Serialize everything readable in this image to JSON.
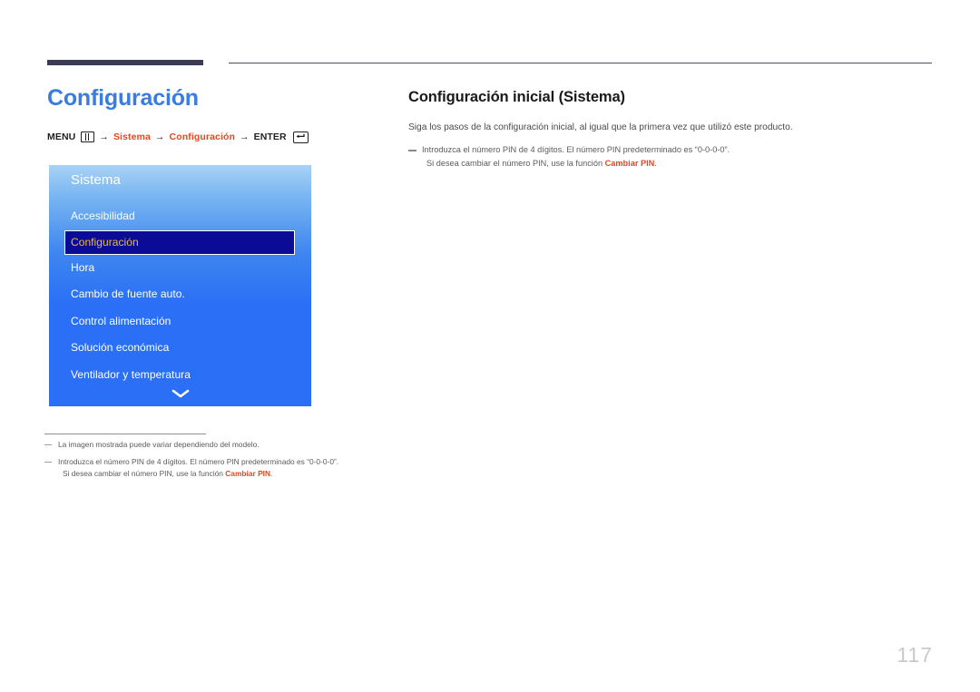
{
  "header": {
    "rule_thick_color": "#3b3b56",
    "rule_thin_color": "#4d4d63"
  },
  "left": {
    "title": "Configuración",
    "title_color": "#3a7ce0",
    "breadcrumb": {
      "menu_label": "MENU",
      "menu_icon": "menu-grid-icon",
      "arrow": "→",
      "item1": "Sistema",
      "item2": "Configuración",
      "enter_label": "ENTER",
      "enter_icon": "enter-return-icon",
      "accent_color": "#e8451f"
    },
    "osd": {
      "header": "Sistema",
      "panel_color": "#2a6ff5",
      "selected_bg": "#0b0b96",
      "selected_text_color": "#e8bd3c",
      "scroll_icon": "chevron-down-icon",
      "items": [
        {
          "label": "Accesibilidad",
          "selected": false
        },
        {
          "label": "Configuración",
          "selected": true
        },
        {
          "label": "Hora",
          "selected": false
        },
        {
          "label": "Cambio de fuente auto.",
          "selected": false
        },
        {
          "label": "Control alimentación",
          "selected": false
        },
        {
          "label": "Solución económica",
          "selected": false
        },
        {
          "label": "Ventilador y temperatura",
          "selected": false
        }
      ]
    },
    "footnotes": [
      {
        "line1": "La imagen mostrada puede variar dependiendo del modelo.",
        "line2": "",
        "line2_prefix": "",
        "line2_highlight": "",
        "line2_suffix": ""
      },
      {
        "line1": "Introduzca el número PIN de 4 dígitos. El número PIN predeterminado es “0-0-0-0”.",
        "line2_prefix": "Si desea cambiar el número PIN, use la función ",
        "line2_highlight": "Cambiar PIN",
        "line2_suffix": "."
      }
    ]
  },
  "right": {
    "title": "Configuración inicial (Sistema)",
    "lead": "Siga los pasos de la configuración inicial, al igual que la primera vez que utilizó este producto.",
    "note": {
      "line1": "Introduzca el número PIN de 4 dígitos. El número PIN predeterminado es “0-0-0-0”.",
      "line2_prefix": "Si desea cambiar el número PIN, use la función ",
      "line2_highlight": "Cambiar PIN",
      "line2_suffix": "."
    }
  },
  "footer": {
    "page_number": "117"
  }
}
